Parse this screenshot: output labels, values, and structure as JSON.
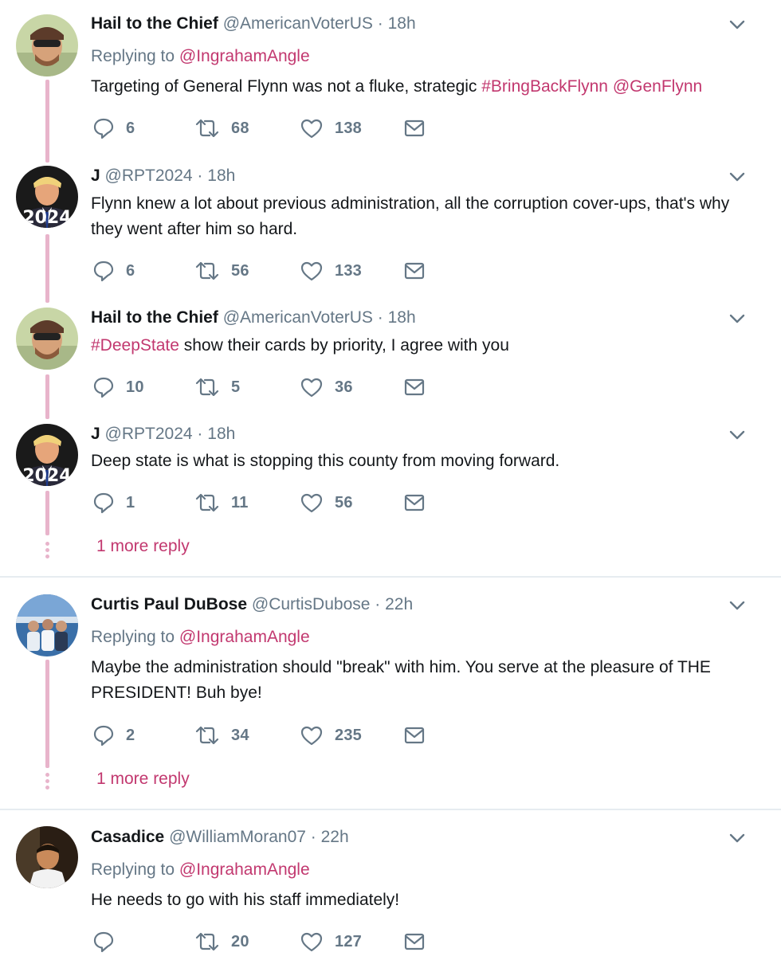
{
  "tweets": [
    {
      "name": "Hail to the Chief",
      "handle": "@AmericanVoterUS",
      "time": "18h",
      "replying_label": "Replying to",
      "replying_to": "@IngrahamAngle",
      "text_plain": "Targeting of General Flynn was not a fluke, strategic ",
      "text_tags": [
        "#BringBackFlynn",
        "@GenFlynn"
      ],
      "replies": "6",
      "retweets": "68",
      "likes": "138"
    },
    {
      "name": "J",
      "handle": "@RPT2024",
      "time": "18h",
      "text": "Flynn knew a lot about previous administration, all the corruption cover-ups, that's why they went after him so hard.",
      "replies": "6",
      "retweets": "56",
      "likes": "133"
    },
    {
      "name": "Hail to the Chief",
      "handle": "@AmericanVoterUS",
      "time": "18h",
      "text_tag": "#DeepState",
      "text_plain": " show their cards by priority, I agree with you",
      "replies": "10",
      "retweets": "5",
      "likes": "36"
    },
    {
      "name": "J",
      "handle": "@RPT2024",
      "time": "18h",
      "text": "Deep state is what is stopping this county from moving forward.",
      "replies": "1",
      "retweets": "11",
      "likes": "56",
      "more_replies": "1 more reply"
    },
    {
      "name": "Curtis Paul DuBose",
      "handle": "@CurtisDubose",
      "time": "22h",
      "replying_label": "Replying to",
      "replying_to": "@IngrahamAngle",
      "text": "Maybe the administration should \"break\" with him. You serve at the pleasure of THE PRESIDENT!  Buh bye!",
      "replies": "2",
      "retweets": "34",
      "likes": "235",
      "more_replies": "1 more reply"
    },
    {
      "name": "Casadice",
      "handle": "@WilliamMoran07",
      "time": "22h",
      "replying_label": "Replying to",
      "replying_to": "@IngrahamAngle",
      "text": "He needs to go with his staff immediately!",
      "replies": "",
      "retweets": "20",
      "likes": "127"
    }
  ],
  "time_separator": "·",
  "colors": {
    "accent": "#c2386f",
    "thread_line": "#e8b4cb",
    "secondary_text": "#657786",
    "divider": "#e6ecf0"
  },
  "icons": [
    "reply-icon",
    "retweet-icon",
    "like-icon",
    "direct-message-icon",
    "chevron-down-icon"
  ]
}
